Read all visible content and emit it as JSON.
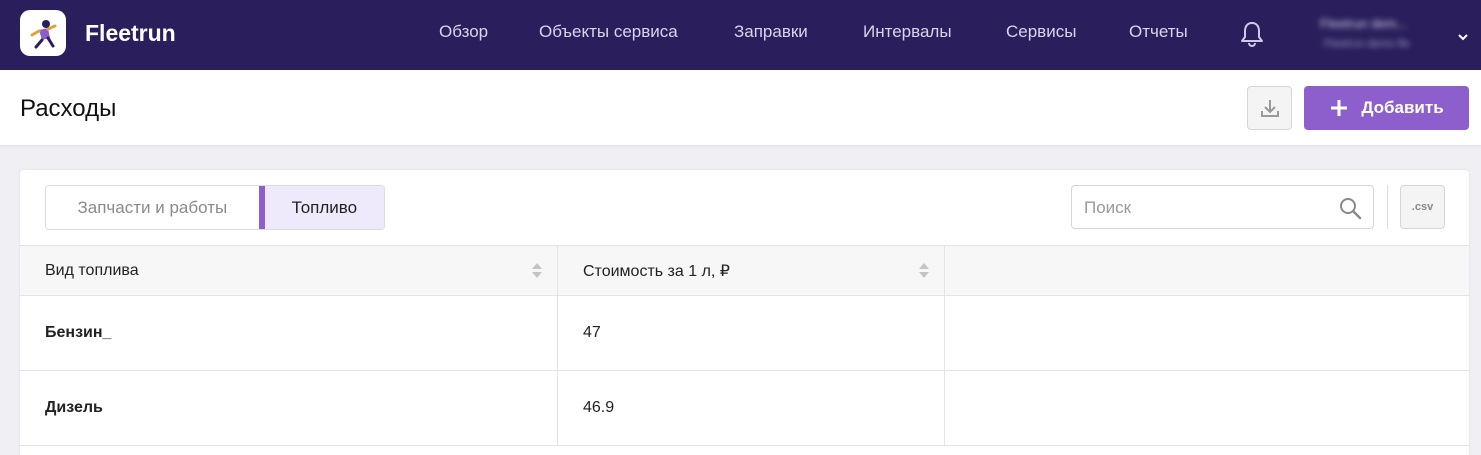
{
  "app": {
    "brand": "Fleetrun"
  },
  "nav": {
    "items": [
      {
        "label": "Обзор"
      },
      {
        "label": "Объекты сервиса"
      },
      {
        "label": "Заправки"
      },
      {
        "label": "Интервалы"
      },
      {
        "label": "Сервисы"
      },
      {
        "label": "Отчеты"
      }
    ],
    "user_name": "Fleetrun dem...",
    "user_sub": "Fleetrun demo fle"
  },
  "header": {
    "title": "Расходы",
    "add_label": "Добавить"
  },
  "tabs": [
    {
      "label": "Запчасти и работы",
      "active": false
    },
    {
      "label": "Топливо",
      "active": true
    }
  ],
  "search": {
    "placeholder": "Поиск"
  },
  "csv_label": ".csv",
  "table": {
    "columns": [
      "Вид топлива",
      "Стоимость за 1 л, ₽",
      ""
    ],
    "rows": [
      {
        "fuel": "Бензин_",
        "cost": "47"
      },
      {
        "fuel": "Дизель",
        "cost": "46.9"
      }
    ]
  },
  "colors": {
    "topbar": "#2a1f5c",
    "accent": "#8c5fcc",
    "active_tab_bg": "#efeafb"
  },
  "icons": {
    "logo": "fleetrun-logo-icon",
    "bell": "bell-icon",
    "chevron": "chevron-down-icon",
    "export": "download-icon",
    "add": "plus-icon",
    "search": "search-icon",
    "sort": "sort-icon"
  }
}
